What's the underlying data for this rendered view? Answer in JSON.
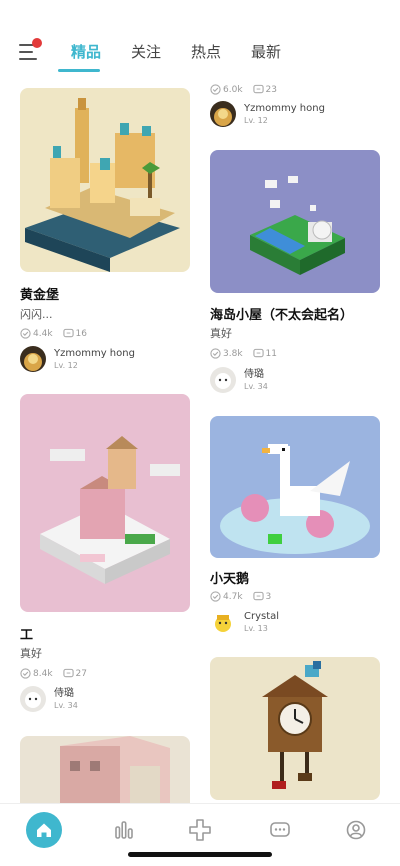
{
  "header": {
    "tabs": [
      {
        "label": "精品",
        "active": true
      },
      {
        "label": "关注",
        "active": false
      },
      {
        "label": "热点",
        "active": false
      },
      {
        "label": "最新",
        "active": false
      }
    ]
  },
  "colors": {
    "accent": "#3fb7ce",
    "notification": "#e23a3a"
  },
  "left_column": [
    {
      "title": "黄金堡",
      "subtitle": "闪闪...",
      "likes": "4.4k",
      "comments": "16",
      "author": {
        "name": "Yzmommy hong",
        "level": "Lv. 12"
      }
    },
    {
      "title": "工",
      "subtitle": "真好",
      "likes": "8.4k",
      "comments": "27",
      "author": {
        "name": "侍璐",
        "level": "Lv. 34"
      }
    }
  ],
  "right_column": [
    {
      "likes": "6.0k",
      "comments": "23",
      "author": {
        "name": "Yzmommy hong",
        "level": "Lv. 12"
      }
    },
    {
      "title": "海岛小屋（不太会起名）",
      "subtitle": "真好",
      "likes": "3.8k",
      "comments": "11",
      "author": {
        "name": "侍璐",
        "level": "Lv. 34"
      }
    },
    {
      "title": "小天鹅",
      "likes": "4.7k",
      "comments": "3",
      "author": {
        "name": "Crystal",
        "level": "Lv. 13"
      }
    }
  ],
  "bottom_nav": [
    {
      "icon": "home-icon",
      "active": true
    },
    {
      "icon": "chart-icon",
      "active": false
    },
    {
      "icon": "plus-icon",
      "active": false
    },
    {
      "icon": "message-icon",
      "active": false
    },
    {
      "icon": "profile-icon",
      "active": false
    }
  ]
}
